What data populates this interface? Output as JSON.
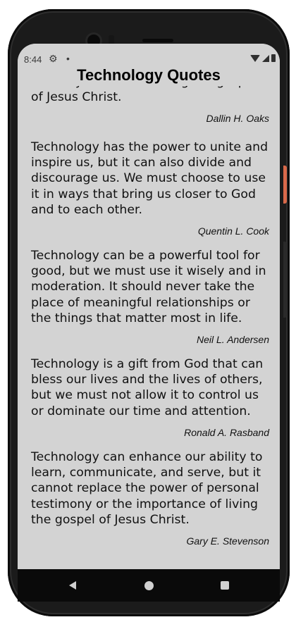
{
  "status_bar": {
    "time": "8:44"
  },
  "app": {
    "title": "Technology Quotes"
  },
  "quotes": [
    {
      "text": "can only come from living the gospel of Jesus Christ.",
      "author": "Dallin H. Oaks"
    },
    {
      "text": "Technology has the power to unite and inspire us, but it can also divide and discourage us. We must choose to use it in ways that bring us closer to God and to each other.",
      "author": "Quentin L. Cook"
    },
    {
      "text": "Technology can be a powerful tool for good, but we must use it wisely and in moderation. It should never take the place of meaningful relationships or the things that matter most in life.",
      "author": "Neil L. Andersen"
    },
    {
      "text": "Technology is a gift from God that can bless our lives and the lives of others, but we must not allow it to control us or dominate our time and attention.",
      "author": "Ronald A. Rasband"
    },
    {
      "text": "Technology can enhance our ability to learn, communicate, and serve, but it cannot replace the power of personal testimony or the importance of living the gospel of Jesus Christ.",
      "author": "Gary E. Stevenson"
    }
  ],
  "icons": {
    "settings": "gear-icon",
    "wifi": "wifi-icon",
    "signal": "cell-signal-icon",
    "battery": "battery-icon",
    "back": "back-icon",
    "home": "home-icon",
    "recents": "recents-icon"
  }
}
